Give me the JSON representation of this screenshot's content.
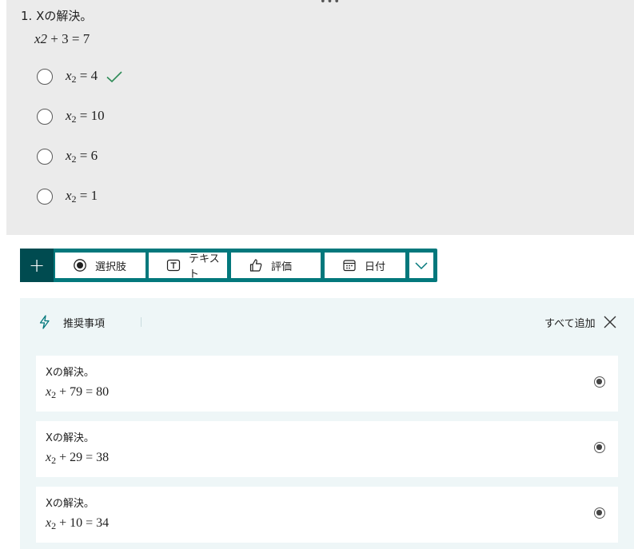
{
  "question": {
    "number": "1.",
    "title": "Xの解決。",
    "equation": {
      "lhs": "x2",
      "rest": "+ 3 = 7"
    },
    "options": [
      {
        "var": "x",
        "sub": "2",
        "rest": "= 4",
        "correct": true
      },
      {
        "var": "x",
        "sub": "2",
        "rest": "= 10",
        "correct": false
      },
      {
        "var": "x",
        "sub": "2",
        "rest": "= 6",
        "correct": false
      },
      {
        "var": "x",
        "sub": "2",
        "rest": "= 1",
        "correct": false
      }
    ]
  },
  "toolbar": {
    "add_icon": "plus-icon",
    "buttons": [
      {
        "label": "選択肢",
        "icon": "radio-button-icon"
      },
      {
        "label": "テキスト",
        "icon": "text-box-icon"
      },
      {
        "label": "評価",
        "icon": "thumbs-up-icon"
      },
      {
        "label": "日付",
        "icon": "calendar-icon"
      }
    ],
    "more_icon": "chevron-down-icon"
  },
  "suggestions": {
    "title": "推奨事項",
    "add_all": "すべて追加",
    "items": [
      {
        "title": "Xの解決。",
        "var": "x",
        "sub": "2",
        "rest": "+ 79 = 80"
      },
      {
        "title": "Xの解決。",
        "var": "x",
        "sub": "2",
        "rest": "+ 29 = 38"
      },
      {
        "title": "Xの解決。",
        "var": "x",
        "sub": "2",
        "rest": "+ 10 = 34"
      }
    ]
  },
  "colors": {
    "accent": "#03787c",
    "accent_dark": "#004b50",
    "check": "#2e8b57",
    "card_bg": "#ebebeb",
    "suggest_bg": "#eef6f7"
  }
}
